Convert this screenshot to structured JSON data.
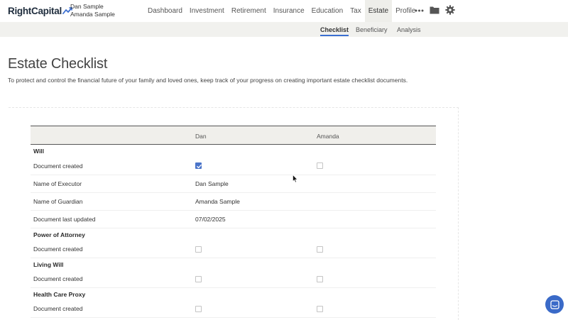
{
  "app": {
    "logo_text": "RightCapital",
    "clients": [
      "Dan Sample",
      "Amanda Sample"
    ]
  },
  "nav": {
    "items": [
      {
        "label": "Dashboard",
        "active": false
      },
      {
        "label": "Investment",
        "active": false
      },
      {
        "label": "Retirement",
        "active": false
      },
      {
        "label": "Insurance",
        "active": false
      },
      {
        "label": "Education",
        "active": false
      },
      {
        "label": "Tax",
        "active": false
      },
      {
        "label": "Estate",
        "active": true
      },
      {
        "label": "Profile",
        "active": false
      }
    ],
    "icons": [
      "more-icon",
      "folder-icon",
      "gear-icon"
    ]
  },
  "subnav": {
    "tabs": [
      {
        "label": "Checklist",
        "active": true
      },
      {
        "label": "Beneficiary",
        "active": false
      },
      {
        "label": "Analysis",
        "active": false
      }
    ]
  },
  "page": {
    "title": "Estate Checklist",
    "description": "To protect and control the financial future of your family and loved ones, keep track of your progress on creating important estate checklist documents."
  },
  "table": {
    "columns": [
      "",
      "Dan",
      "Amanda"
    ],
    "sections": [
      {
        "name": "Will",
        "rows": [
          {
            "label": "Document created",
            "dan": {
              "type": "checkbox",
              "checked": true
            },
            "amanda": {
              "type": "checkbox",
              "checked": false
            }
          },
          {
            "label": "Name of Executor",
            "dan": {
              "type": "text",
              "value": "Dan Sample"
            },
            "amanda": {
              "type": "text",
              "value": ""
            }
          },
          {
            "label": "Name of Guardian",
            "dan": {
              "type": "text",
              "value": "Amanda Sample"
            },
            "amanda": {
              "type": "text",
              "value": ""
            }
          },
          {
            "label": "Document last updated",
            "dan": {
              "type": "text",
              "value": "07/02/2025"
            },
            "amanda": {
              "type": "text",
              "value": ""
            }
          }
        ]
      },
      {
        "name": "Power of Attorney",
        "rows": [
          {
            "label": "Document created",
            "dan": {
              "type": "checkbox",
              "checked": false
            },
            "amanda": {
              "type": "checkbox",
              "checked": false
            }
          }
        ]
      },
      {
        "name": "Living Will",
        "rows": [
          {
            "label": "Document created",
            "dan": {
              "type": "checkbox",
              "checked": false
            },
            "amanda": {
              "type": "checkbox",
              "checked": false
            }
          }
        ]
      },
      {
        "name": "Health Care Proxy",
        "rows": [
          {
            "label": "Document created",
            "dan": {
              "type": "checkbox",
              "checked": false
            },
            "amanda": {
              "type": "checkbox",
              "checked": false
            }
          }
        ]
      }
    ]
  },
  "colors": {
    "accent": "#3b6fd1",
    "checkbox_checked": "#4a74c9",
    "subnav_bg": "#f1f1ee",
    "header_bg": "#f0efeb",
    "chat_button": "#3a6ac8"
  }
}
